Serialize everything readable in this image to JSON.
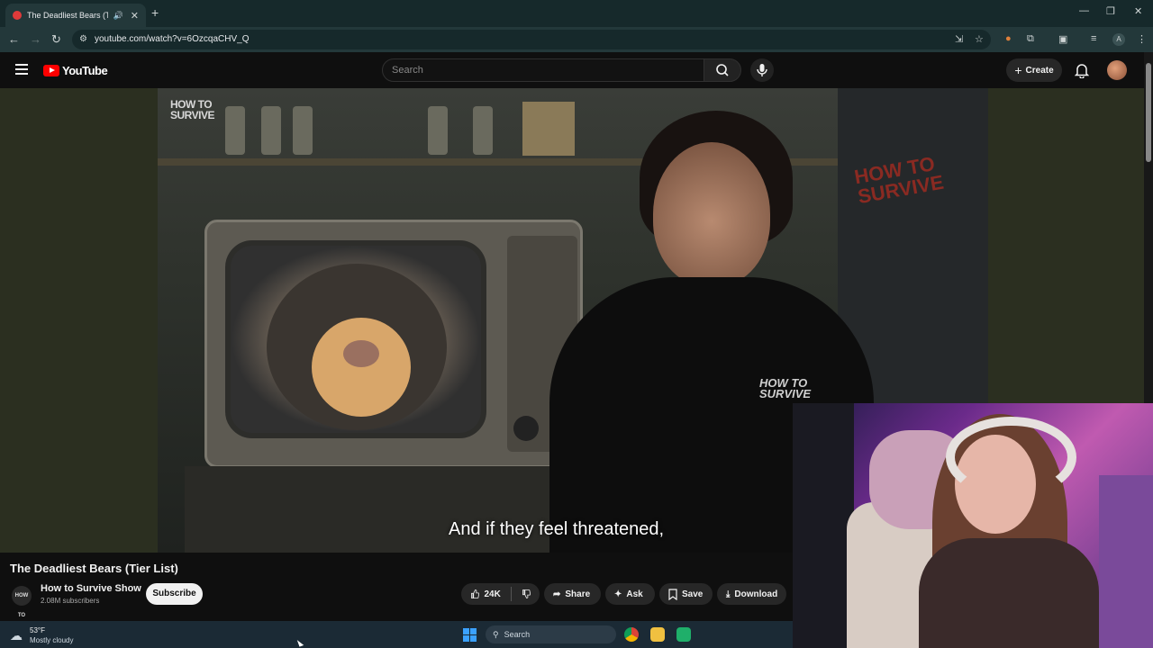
{
  "browser": {
    "tab_title": "The Deadliest Bears (Tier Li",
    "url": "youtube.com/watch?v=6OzcqaCHV_Q",
    "new_tab_label": "+",
    "avatar_letter": "A"
  },
  "masthead": {
    "logo_text": "YouTube",
    "search_placeholder": "Search",
    "create_label": "Create"
  },
  "video": {
    "corner_logo_line1": "HOW TO",
    "corner_logo_line2": "SURVIVE",
    "shirt_logo_line1": "HOW TO",
    "shirt_logo_line2": "SURVIVE",
    "graffiti_line1": "HOW TO",
    "graffiti_line2": "SURVIVE",
    "caption": "And if they feel threatened,"
  },
  "details": {
    "title": "The Deadliest Bears (Tier List)",
    "channel_name": "How to Survive Show",
    "channel_avatar_text": "HOW TO SURVIVE",
    "subscribers": "2.08M subscribers",
    "subscribe_label": "Subscribe",
    "like_count": "24K",
    "share_label": "Share",
    "ask_label": "Ask",
    "save_label": "Save",
    "download_label": "Download"
  },
  "taskbar": {
    "temperature": "53°F",
    "weather_desc": "Mostly cloudy",
    "search_label": "Search"
  },
  "colors": {
    "youtube_red": "#ff0000",
    "page_bg": "#0f0f0f",
    "chrome_bg": "#23383a",
    "taskbar_bg": "#1b2a35"
  }
}
